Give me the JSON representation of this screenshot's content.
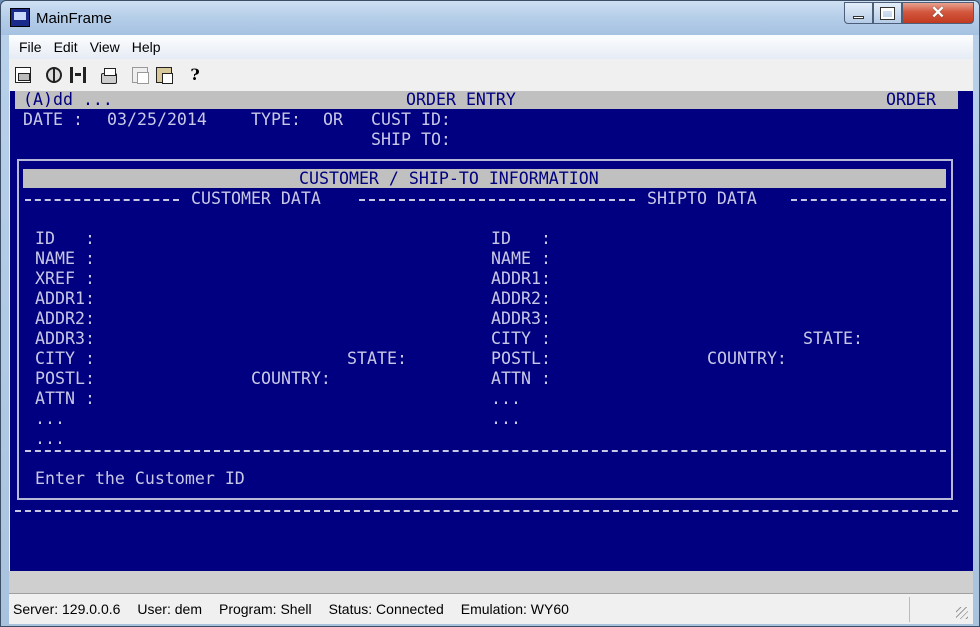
{
  "window": {
    "title": "MainFrame"
  },
  "menu": [
    "File",
    "Edit",
    "View",
    "Help"
  ],
  "toolbar": {
    "buttons": [
      "properties-icon",
      "disconnect-icon",
      "connect-icon",
      "print-icon",
      "copy-icon",
      "paste-icon",
      "help-icon"
    ],
    "help_glyph": "?"
  },
  "terminal": {
    "header": {
      "mode": "(A)dd ...",
      "screen": "ORDER ENTRY",
      "right": "ORDER"
    },
    "line2": {
      "date_label": "DATE :",
      "date": "03/25/2014",
      "type_label": "TYPE:",
      "type": "OR",
      "cust_label": "CUST ID:"
    },
    "line3": {
      "ship_label": "SHIP TO:"
    },
    "panel_title": "CUSTOMER / SHIP-TO INFORMATION",
    "section_customer": "CUSTOMER DATA",
    "section_shipto": "SHIPTO DATA",
    "customer_fields": [
      "ID   :",
      "NAME :",
      "XREF :",
      "ADDR1:",
      "ADDR2:",
      "ADDR3:",
      "CITY :",
      "POSTL:",
      "ATTN :",
      "...",
      "..."
    ],
    "customer_state": "STATE:",
    "customer_country": "COUNTRY:",
    "shipto_fields": [
      "ID   :",
      "NAME :",
      "ADDR1:",
      "ADDR2:",
      "ADDR3:",
      "CITY :",
      "POSTL:",
      "ATTN :",
      "...",
      "..."
    ],
    "shipto_state": "STATE:",
    "shipto_country": "COUNTRY:",
    "prompt": "Enter the Customer ID"
  },
  "status": {
    "server": "Server: 129.0.0.6",
    "user": "User: dem",
    "program": "Program: Shell",
    "status": "Status: Connected",
    "emulation": "Emulation: WY60"
  }
}
